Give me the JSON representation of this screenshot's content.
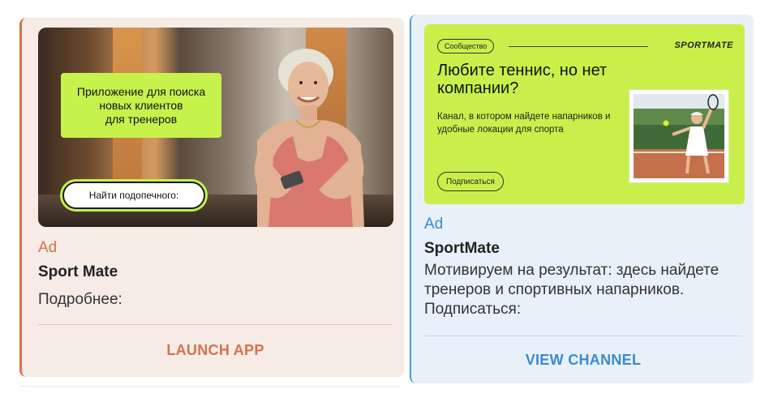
{
  "card1": {
    "promo_text": "Приложение для поиска\nновых клиентов\nдля тренеров",
    "pill_text": "Найти подопечного:",
    "ad_label": "Ad",
    "title": "Sport Mate",
    "description": "Подробнее:",
    "action_label": "LAUNCH APP",
    "accent_color": "#d4744a"
  },
  "card2": {
    "community_tag": "Сообщество",
    "brand": "SPORTMATE",
    "headline": "Любите теннис, но нет компании?",
    "subtext": "Канал, в котором найдете напарников и удобные локации для спорта",
    "subscribe_label": "Подписаться",
    "ad_label": "Ad",
    "title": "SportMate",
    "description": "Мотивируем на результат: здесь найдете тренеров и спортивных напарников. Подписаться:",
    "action_label": "VIEW CHANNEL",
    "accent_color": "#3a8ad0",
    "banner_color": "#c9f04a"
  }
}
